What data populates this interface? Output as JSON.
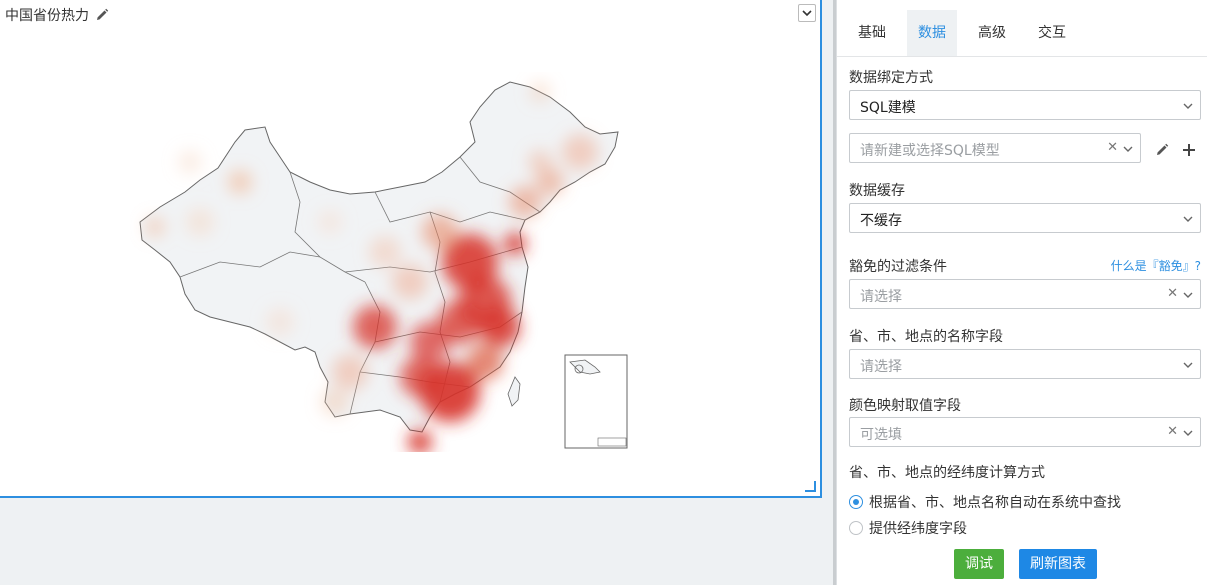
{
  "chart": {
    "title": "中国省份热力",
    "edit_icon": "pencil-icon",
    "collapse_icon": "chevron-down-icon"
  },
  "panel": {
    "tabs": [
      {
        "label": "基础",
        "active": false
      },
      {
        "label": "数据",
        "active": true
      },
      {
        "label": "高级",
        "active": false
      },
      {
        "label": "交互",
        "active": false
      }
    ],
    "binding": {
      "label": "数据绑定方式",
      "value": "SQL建模"
    },
    "sql_model": {
      "placeholder": "请新建或选择SQL模型"
    },
    "cache": {
      "label": "数据缓存",
      "value": "不缓存"
    },
    "filter": {
      "label": "豁免的过滤条件",
      "help": "什么是『豁免』?",
      "placeholder": "请选择"
    },
    "name_field": {
      "label": "省、市、地点的名称字段",
      "placeholder": "请选择"
    },
    "color_field": {
      "label": "颜色映射取值字段",
      "placeholder": "可选填"
    },
    "calc": {
      "label": "省、市、地点的经纬度计算方式",
      "options": [
        {
          "label": "根据省、市、地点名称自动在系统中查找",
          "checked": true
        },
        {
          "label": "提供经纬度字段",
          "checked": false
        }
      ]
    },
    "buttons": {
      "debug": "调试",
      "refresh": "刷新图表"
    },
    "colors": {
      "accent": "#2d8fe0",
      "debug": "#4cae3c",
      "refresh": "#1e88e5"
    }
  }
}
